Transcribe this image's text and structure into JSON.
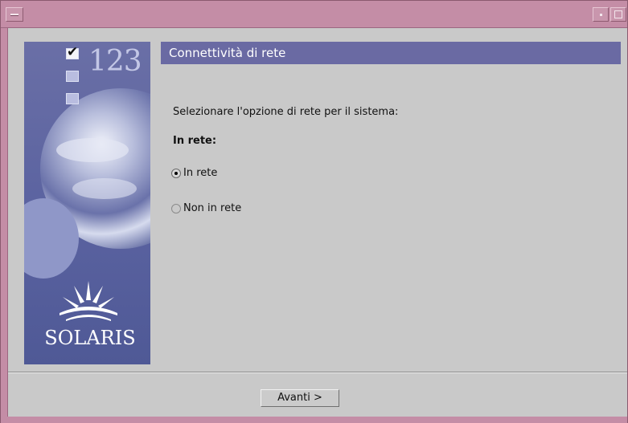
{
  "window": {
    "menu_icon": "window-menu-icon",
    "minimize_icon": "minimize-icon",
    "maximize_icon": "maximize-icon"
  },
  "side_panel": {
    "steps_number": "123",
    "brand": "SOLARIS",
    "checkbox_icon": "checkbox-icon",
    "checkmark": "✔",
    "logo_icon": "solaris-sun-logo-icon"
  },
  "header": {
    "title": "Connettività di rete"
  },
  "main": {
    "prompt": "Selezionare l'opzione di rete per il sistema:",
    "group_label": "In rete:",
    "options": [
      {
        "label": "In rete",
        "selected": true
      },
      {
        "label": "Non in rete",
        "selected": false
      }
    ]
  },
  "footer": {
    "next_label": "Avanti >"
  },
  "colors": {
    "titlebar": "#c48da6",
    "header_bar": "#6a6aa3",
    "background": "#c9c9c9",
    "panel": "#5a62a0"
  }
}
